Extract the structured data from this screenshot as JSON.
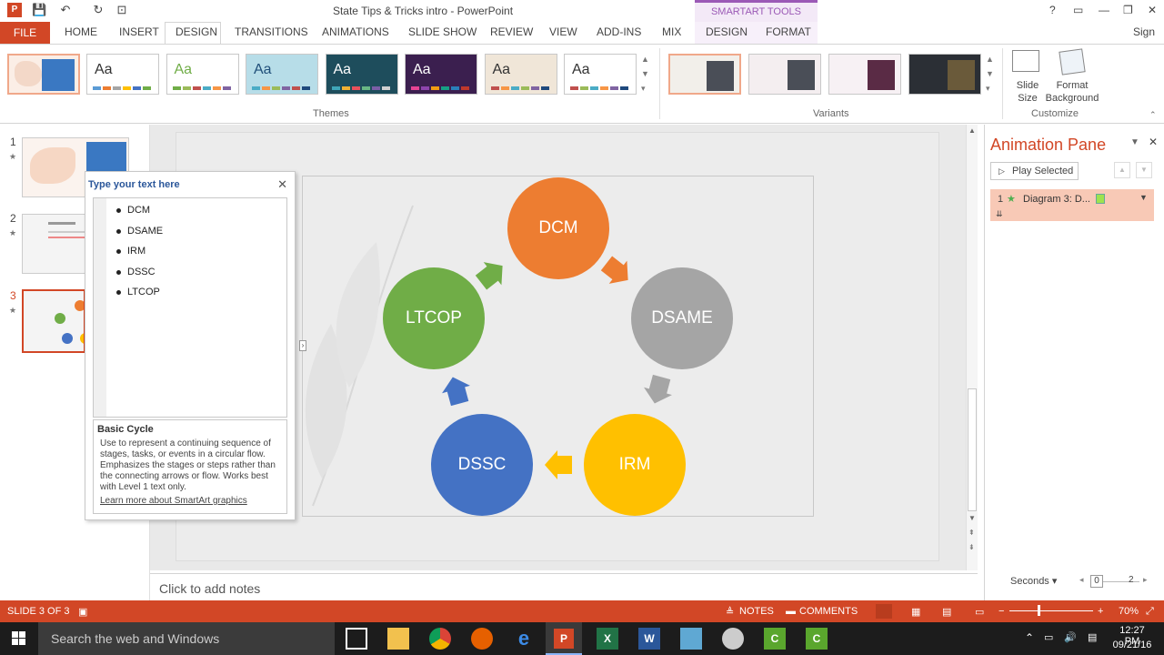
{
  "window": {
    "title": "State Tips & Tricks intro - PowerPoint",
    "contextual_group": "SMARTART TOOLS",
    "help": "?",
    "sign_in": "Sign"
  },
  "tabs": [
    "FILE",
    "HOME",
    "INSERT",
    "DESIGN",
    "TRANSITIONS",
    "ANIMATIONS",
    "SLIDE SHOW",
    "REVIEW",
    "VIEW",
    "ADD-INS",
    "MIX",
    "DESIGN",
    "FORMAT"
  ],
  "ribbon": {
    "themes_label": "Themes",
    "variants_label": "Variants",
    "customize_label": "Customize",
    "theme_aa": "Aa",
    "slide_size": "Slide Size",
    "format_background": "Format Background",
    "themes": [
      {
        "bg": "#ffffff",
        "fg": "#333333",
        "bars": [
          "#5b9bd5",
          "#ed7d31",
          "#a5a5a5",
          "#ffc000",
          "#4472c4",
          "#70ad47"
        ]
      },
      {
        "bg": "#ffffff",
        "fg": "#70ad47",
        "bars": [
          "#70ad47",
          "#9bbb59",
          "#c0504d",
          "#4bacc6",
          "#f79646",
          "#8064a2"
        ]
      },
      {
        "bg": "#b7dde8",
        "fg": "#1f4e79",
        "bars": [
          "#4bacc6",
          "#f79646",
          "#9bbb59",
          "#8064a2",
          "#c0504d",
          "#1f497d"
        ]
      },
      {
        "bg": "#1e4d5c",
        "fg": "#ffffff",
        "bars": [
          "#3fa6b8",
          "#f2b134",
          "#e8505b",
          "#68b684",
          "#7b5ea7",
          "#d0d0d0"
        ]
      },
      {
        "bg": "#3b1f4f",
        "fg": "#ffffff",
        "bars": [
          "#e84393",
          "#8e44ad",
          "#f39c12",
          "#16a085",
          "#2980b9",
          "#c0392b"
        ]
      },
      {
        "bg": "#f0e6d8",
        "fg": "#333333",
        "bars": [
          "#c0504d",
          "#f79646",
          "#4bacc6",
          "#9bbb59",
          "#8064a2",
          "#1f497d"
        ]
      },
      {
        "bg": "#ffffff",
        "fg": "#333333",
        "bars": [
          "#c0504d",
          "#9bbb59",
          "#4bacc6",
          "#f79646",
          "#8064a2",
          "#1f497d"
        ]
      }
    ],
    "variants": [
      {
        "bg": "#f2efea",
        "sw": "#4a4e57"
      },
      {
        "bg": "#f4eef0",
        "sw": "#4a4e57"
      },
      {
        "bg": "#f7f1f4",
        "sw": "#5a2b45"
      },
      {
        "bg": "#2b2f35",
        "sw": "#6a5a3a"
      }
    ]
  },
  "slides": [
    {
      "number": "1",
      "star": "★"
    },
    {
      "number": "2",
      "star": "★"
    },
    {
      "number": "3",
      "star": "★"
    }
  ],
  "text_pane": {
    "title": "Type your text here",
    "items": [
      "DCM",
      "DSAME",
      "IRM",
      "DSSC",
      "LTCOP"
    ],
    "layout_name": "Basic Cycle",
    "layout_desc": "Use to represent a continuing sequence of stages, tasks, or events in a circular flow. Emphasizes the stages or steps rather than the connecting arrows or flow. Works best with Level 1 text only.",
    "learn_more": "Learn more about SmartArt graphics"
  },
  "diagram": {
    "nodes": [
      {
        "label": "DCM",
        "color": "#ed7d31"
      },
      {
        "label": "DSAME",
        "color": "#a5a5a5"
      },
      {
        "label": "IRM",
        "color": "#ffc000"
      },
      {
        "label": "DSSC",
        "color": "#4472c4"
      },
      {
        "label": "LTCOP",
        "color": "#70ad47"
      }
    ]
  },
  "notes_placeholder": "Click to add notes",
  "animation_pane": {
    "title": "Animation Pane",
    "play_selected": "Play Selected",
    "item_number": "1",
    "item_label": "Diagram 3: D...",
    "seconds": "Seconds",
    "timeline_start": "0",
    "timeline_end": "2"
  },
  "status_bar": {
    "slide_info": "SLIDE 3 OF 3",
    "notes": "NOTES",
    "comments": "COMMENTS",
    "zoom": "70%"
  },
  "taskbar": {
    "search_placeholder": "Search the web and Windows",
    "time": "12:27 PM",
    "date": "09/21/16"
  }
}
